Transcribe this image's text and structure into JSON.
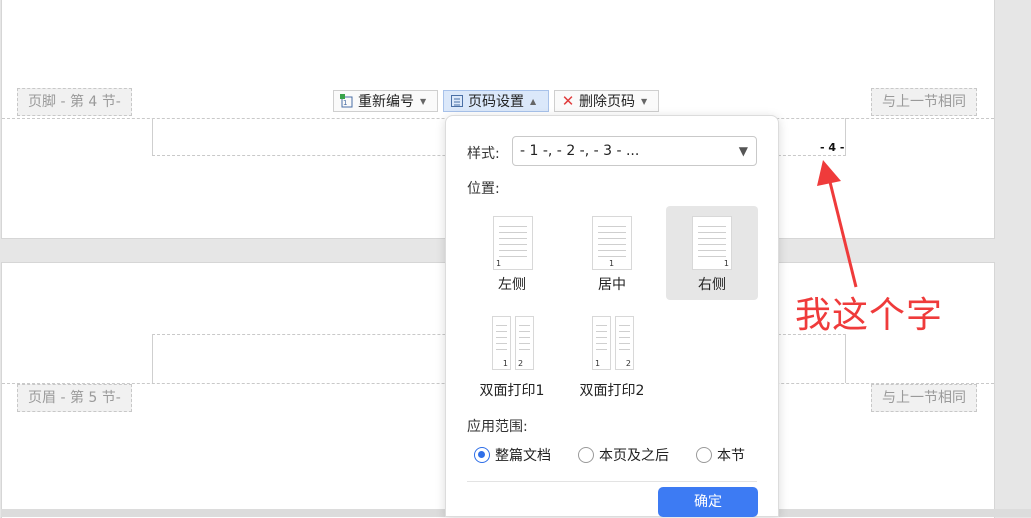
{
  "page1": {
    "footer_label": "页脚 - 第 4 节-",
    "same_as_prev": "与上一节相同",
    "page_number": "- 4 -"
  },
  "page2": {
    "header_label": "页眉 - 第 5 节-",
    "same_as_prev": "与上一节相同"
  },
  "toolbar": {
    "renumber": "重新编号",
    "page_setup": "页码设置",
    "delete": "删除页码"
  },
  "dialog": {
    "style_label": "样式:",
    "style_value": "- 1 -, - 2 -, - 3 - ...",
    "position_label": "位置:",
    "positions": {
      "left": "左侧",
      "center": "居中",
      "right": "右侧",
      "duplex1": "双面打印1",
      "duplex2": "双面打印2"
    },
    "selected_position": "右侧",
    "scope_label": "应用范围:",
    "scope": {
      "whole": "整篇文档",
      "from_here": "本页及之后",
      "section": "本节"
    },
    "selected_scope": "整篇文档",
    "ok": "确定"
  },
  "thumbs": {
    "n1": "1",
    "n2": "2"
  },
  "annotation": {
    "text": "我这个字",
    "color": "#ef3b3b"
  },
  "colors": {
    "accent": "#3d7bf3"
  }
}
